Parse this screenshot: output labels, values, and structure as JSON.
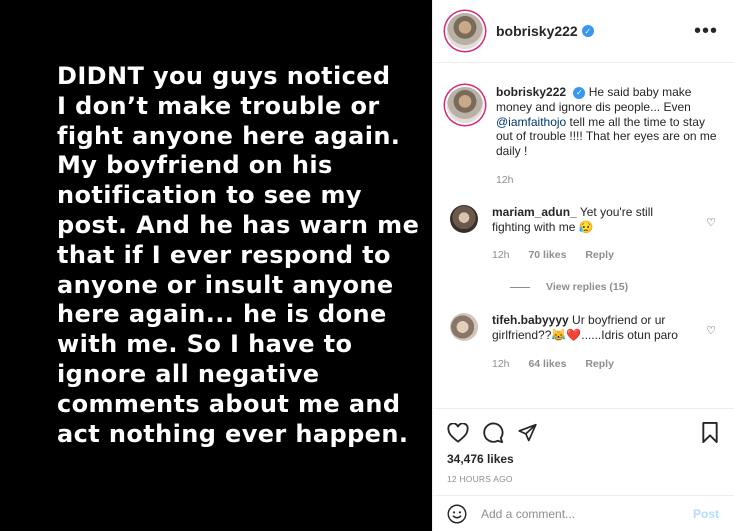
{
  "post": {
    "image_text": "DIDNT you guys noticed\nI don’t make trouble or\nfight anyone here again.\nMy boyfriend on his\nnotification to see my\npost. And he has warn me\nthat if I ever respond to\nanyone or insult anyone\nhere again... he is done\nwith me. So I have to\nignore all negative\ncomments about me and\nact nothing ever happen."
  },
  "header": {
    "username": "bobrisky222",
    "verified_icon": "check",
    "more_label": "•••"
  },
  "caption": {
    "username": "bobrisky222",
    "text_before": "He said baby make money and ignore dis people... Even ",
    "mention": "@iamfaithojo",
    "text_after": " tell me all the time to stay out of trouble !!!! That her eyes are on me daily !",
    "time": "12h"
  },
  "comments": [
    {
      "username": "mariam_adun_",
      "text": "Yet you're still fighting with me 😥",
      "time": "12h",
      "likes": "70 likes",
      "reply_label": "Reply",
      "avatar_color": "#6b5a4c"
    },
    {
      "username": "tifeh.babyyyy",
      "text": "Ur boyfriend or ur girlfriend??😹❤️......Idris otun paro",
      "time": "12h",
      "likes": "64 likes",
      "reply_label": "Reply",
      "avatar_color": "#8a7566"
    }
  ],
  "view_replies_label": "View replies (15)",
  "actions": {
    "likes_count": "34,476 likes",
    "posted_ago": "12 HOURS AGO"
  },
  "add_comment": {
    "placeholder": "Add a comment...",
    "post_label": "Post"
  }
}
